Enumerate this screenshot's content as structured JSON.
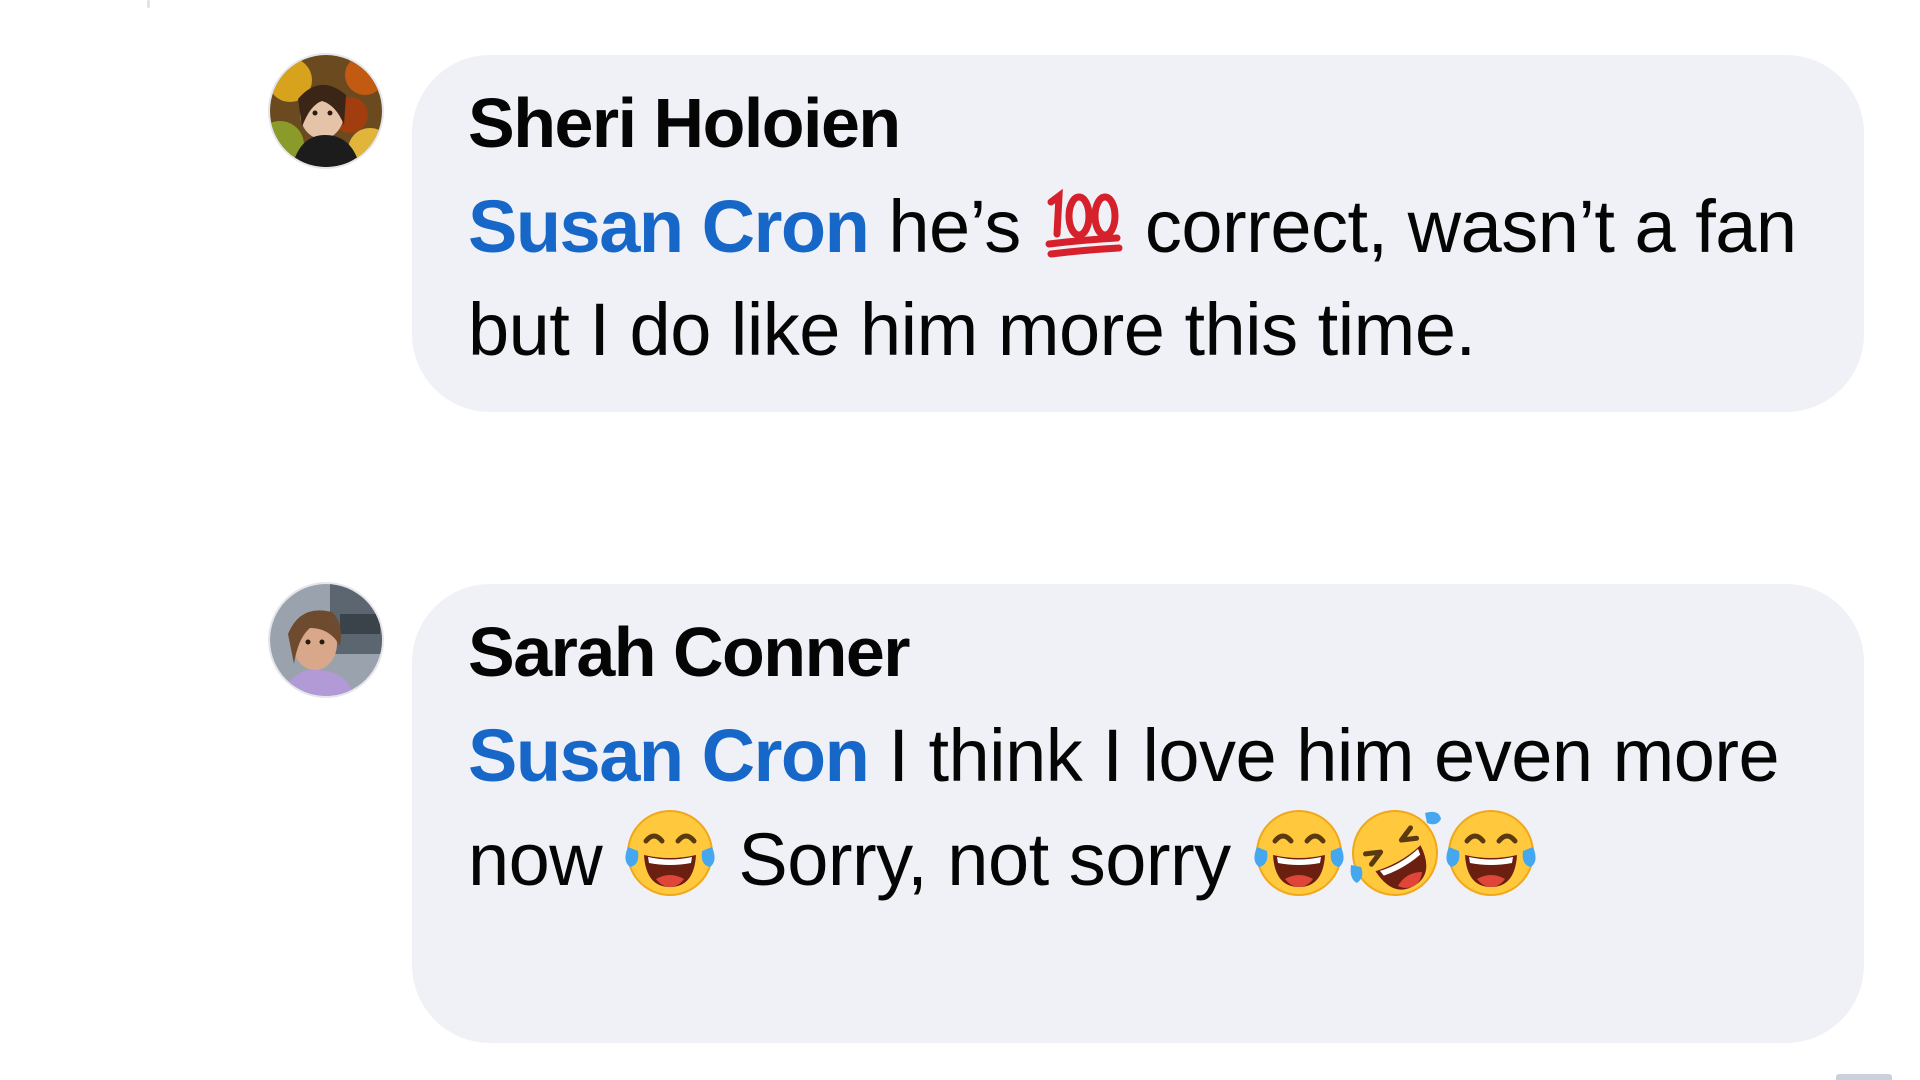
{
  "comments": [
    {
      "author": "Sheri Holoien",
      "mention": "Susan Cron",
      "text_a": " he’s ",
      "emoji_1": "hundred-points-emoji",
      "text_b": " correct, wasn’t a fan but I do like him more this time."
    },
    {
      "author": "Sarah Conner",
      "mention": "Susan Cron",
      "text_a": " I think I love him even more now ",
      "emoji_1": "tears-of-joy-emoji",
      "text_b": " Sorry, not sorry ",
      "emoji_2": "tears-of-joy-emoji",
      "emoji_3": "rolling-on-floor-laughing-emoji",
      "emoji_4": "tears-of-joy-emoji"
    }
  ],
  "colors": {
    "bubble": "#eff1f6",
    "mention": "#1667c7",
    "text": "#050505"
  }
}
